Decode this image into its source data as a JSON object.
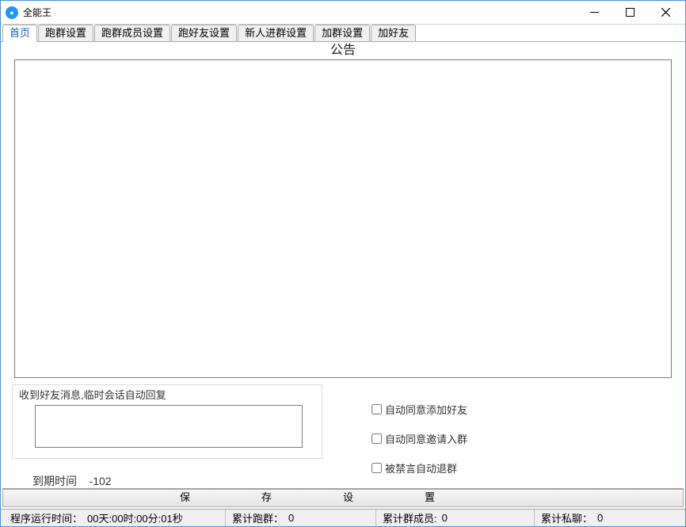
{
  "window": {
    "title": "全能王"
  },
  "tabs": [
    {
      "label": "首页",
      "active": true
    },
    {
      "label": "跑群设置"
    },
    {
      "label": "跑群成员设置"
    },
    {
      "label": "跑好友设置"
    },
    {
      "label": "新人进群设置"
    },
    {
      "label": "加群设置"
    },
    {
      "label": "加好友"
    }
  ],
  "announcement": {
    "title": "公告"
  },
  "autoreply": {
    "label": "收到好友消息,临时会话自动回复",
    "value": ""
  },
  "expire": {
    "label": "到期时间",
    "value": "-102"
  },
  "checks": {
    "auto_accept_friend": "自动同意添加好友",
    "auto_accept_group_invite": "自动同意邀请入群",
    "auto_leave_when_muted": "被禁言自动退群"
  },
  "buttons": {
    "save_settings": "保存设置"
  },
  "status": {
    "runtime_label": "程序运行时间：",
    "runtime_value": "00天:00时:00分:01秒",
    "run_group_label": "累计跑群：",
    "run_group_value": "0",
    "group_members_label": "累计群成员:",
    "group_members_value": "0",
    "private_chat_label": "累计私聊：",
    "private_chat_value": "0"
  }
}
